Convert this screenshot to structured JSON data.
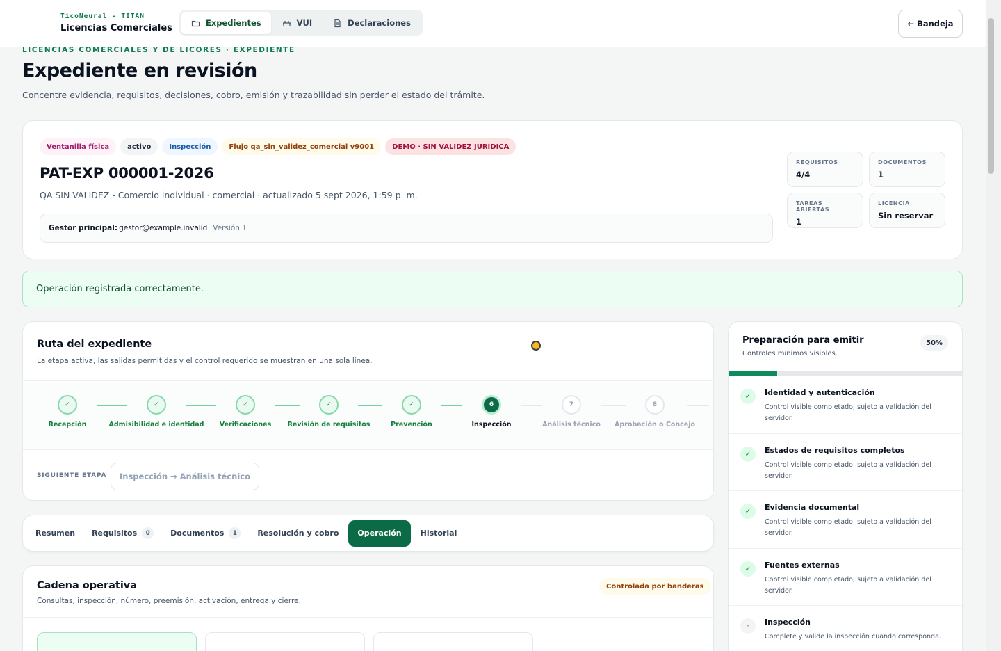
{
  "header": {
    "brand_small": "TicoNeural - TITAN",
    "brand_title": "Licencias Comerciales",
    "nav": [
      {
        "label": "Expedientes",
        "icon": "folder-icon",
        "active": true
      },
      {
        "label": "VUI",
        "icon": "route-icon",
        "active": false
      },
      {
        "label": "Declaraciones",
        "icon": "document-icon",
        "active": false
      }
    ],
    "back_button": "← Bandeja"
  },
  "page": {
    "eyebrow": "LICENCIAS COMERCIALES Y DE LICORES · EXPEDIENTE",
    "title": "Expediente en revisión",
    "subtitle": "Concentre evidencia, requisitos, decisiones, cobro, emisión y trazabilidad sin perder el estado del trámite."
  },
  "summary": {
    "chips": [
      "Ventanilla física",
      "activo",
      "Inspección",
      "Flujo qa_sin_validez_comercial v9001",
      "DEMO · SIN VALIDEZ JURÍDICA"
    ],
    "expediente_id": "PAT-EXP 000001-2026",
    "meta": "QA SIN VALIDEZ - Comercio individual · comercial · actualizado 5 sept 2026, 1:59 p. m.",
    "gestor_label": "Gestor principal:",
    "gestor_value": "gestor@example.invalid",
    "version": "Versión 1",
    "stats": [
      {
        "label": "REQUISITOS",
        "value": "4/4"
      },
      {
        "label": "DOCUMENTOS",
        "value": "1"
      },
      {
        "label": "TAREAS ABIERTAS",
        "value": "1"
      },
      {
        "label": "LICENCIA",
        "value": "Sin reservar"
      }
    ]
  },
  "alert": {
    "message": "Operación registrada correctamente.",
    "color": "#ecfdf3"
  },
  "route": {
    "title": "Ruta del expediente",
    "subtitle": "La etapa activa, las salidas permitidas y el control requerido se muestran en una sola línea.",
    "steps": [
      {
        "name": "Recepción",
        "status": "done",
        "marker": "✓"
      },
      {
        "name": "Admisibilidad e identidad",
        "status": "done",
        "marker": "✓"
      },
      {
        "name": "Verificaciones",
        "status": "done",
        "marker": "✓"
      },
      {
        "name": "Revisión de requisitos",
        "status": "done",
        "marker": "✓"
      },
      {
        "name": "Prevención",
        "status": "done",
        "marker": "✓"
      },
      {
        "name": "Inspección",
        "status": "current",
        "marker": "6"
      },
      {
        "name": "Análisis técnico",
        "status": "pending",
        "marker": "7"
      },
      {
        "name": "Aprobación o Concejo",
        "status": "pending",
        "marker": "8"
      }
    ],
    "next_label": "SIGUIENTE ETAPA",
    "next_value": "Inspección → Análisis técnico"
  },
  "tabs": [
    {
      "label": "Resumen",
      "count": null,
      "active": false
    },
    {
      "label": "Requisitos",
      "count": "0",
      "active": false
    },
    {
      "label": "Documentos",
      "count": "1",
      "active": false
    },
    {
      "label": "Resolución y cobro",
      "count": null,
      "active": false
    },
    {
      "label": "Operación",
      "count": null,
      "active": true
    },
    {
      "label": "Historial",
      "count": null,
      "active": false
    }
  ],
  "cadena": {
    "title": "Cadena operativa",
    "subtitle": "Consultas, inspección, número, preemisión, activación, entrega y cierre.",
    "badge": "Controlada por banderas"
  },
  "prep": {
    "title": "Preparación para emitir",
    "subtitle": "Controles mínimos visibles.",
    "percent_label": "50%",
    "progress": 0.5,
    "accent": "#0f8a5a",
    "controls": [
      {
        "title": "Identidad y autenticación",
        "desc": "Control visible completado; sujeto a validación del servidor.",
        "status": "ok",
        "marker": "✓"
      },
      {
        "title": "Estados de requisitos completos",
        "desc": "Control visible completado; sujeto a validación del servidor.",
        "status": "ok",
        "marker": "✓"
      },
      {
        "title": "Evidencia documental",
        "desc": "Control visible completado; sujeto a validación del servidor.",
        "status": "ok",
        "marker": "✓"
      },
      {
        "title": "Fuentes externas",
        "desc": "Control visible completado; sujeto a validación del servidor.",
        "status": "ok",
        "marker": "✓"
      },
      {
        "title": "Inspección",
        "desc": "Complete y valide la inspección cuando corresponda.",
        "status": "pend",
        "marker": "·"
      }
    ]
  }
}
